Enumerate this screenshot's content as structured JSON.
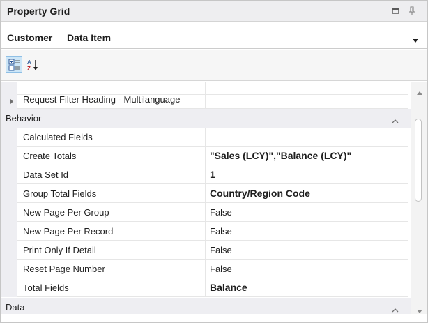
{
  "window": {
    "title": "Property Grid",
    "maximize_icon": "maximize-icon",
    "pin_icon": "pin-icon"
  },
  "object_selector": {
    "object_name": "Customer",
    "object_type": "Data Item",
    "dropdown_icon": "chevron-down-icon"
  },
  "toolbar": {
    "categorized_icon": "categorized-view-icon",
    "alphabetical_icon": "sort-az-icon",
    "active": "categorized"
  },
  "grid": {
    "clipped_row": {
      "name": "Request Filter Heading - Multilanguage"
    },
    "categories": [
      {
        "label": "Behavior",
        "expanded": true,
        "properties": [
          {
            "name": "Calculated Fields",
            "value": "",
            "bold": false
          },
          {
            "name": "Create Totals",
            "value": "\"Sales (LCY)\",\"Balance (LCY)\"",
            "bold": true
          },
          {
            "name": "Data Set Id",
            "value": "1",
            "bold": true
          },
          {
            "name": "Group Total Fields",
            "value": "Country/Region Code",
            "bold": true
          },
          {
            "name": "New Page Per Group",
            "value": "False",
            "bold": false
          },
          {
            "name": "New Page Per Record",
            "value": "False",
            "bold": false
          },
          {
            "name": "Print Only If Detail",
            "value": "False",
            "bold": false
          },
          {
            "name": "Reset Page Number",
            "value": "False",
            "bold": false
          },
          {
            "name": "Total Fields",
            "value": "Balance",
            "bold": true
          }
        ]
      },
      {
        "label": "Data",
        "expanded": true,
        "properties": []
      }
    ]
  },
  "colors": {
    "titlebar_bg": "#eeeef0",
    "category_bg": "#eeeef2",
    "selected_toolbar_bg": "#cde6f7",
    "grid_line": "#e6e6e6"
  }
}
